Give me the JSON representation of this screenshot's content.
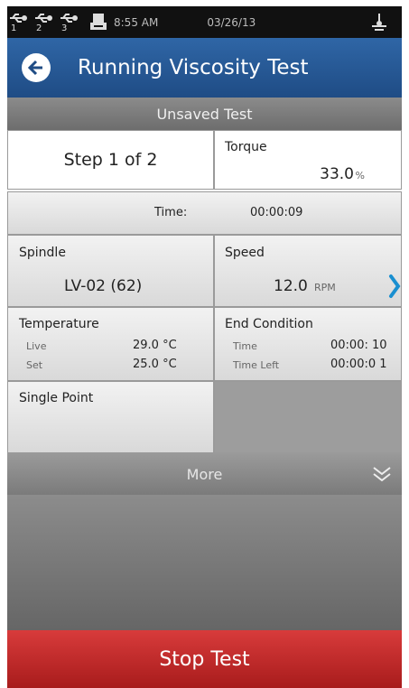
{
  "status_bar": {
    "usb_ports": [
      "1",
      "2",
      "3"
    ],
    "time": "8:55 AM",
    "date": "03/26/13",
    "icons": [
      "usb-icon",
      "printer-icon",
      "connection-icon"
    ]
  },
  "header": {
    "title": "Running Viscosity Test",
    "back_icon": "back-arrow-icon",
    "color": "#2a5f9e"
  },
  "subheader": {
    "text": "Unsaved Test"
  },
  "step": {
    "text": "Step  1 of 2"
  },
  "torque": {
    "label": "Torque",
    "value": "33.0",
    "unit": "%"
  },
  "time": {
    "label": "Time:",
    "value": "00:00:09"
  },
  "spindle": {
    "label": "Spindle",
    "value": "LV-02 (62)"
  },
  "speed": {
    "label": "Speed",
    "value": "12.0",
    "unit": "RPM",
    "chevron_icon": "chevron-right-icon",
    "chevron_color": "#1a8fd0"
  },
  "temperature": {
    "label": "Temperature",
    "live_label": "Live",
    "live_value": "29.0 °C",
    "set_label": "Set",
    "set_value": "25.0 °C"
  },
  "end_condition": {
    "label": "End Condition",
    "time_label": "Time",
    "time_value": "00:00: 10",
    "time_left_label": "Time Left",
    "time_left_value": "00:00:0 1"
  },
  "single_point": {
    "label": "Single Point"
  },
  "more": {
    "label": "More",
    "icon": "double-chevron-down-icon"
  },
  "stop": {
    "label": "Stop Test",
    "color": "#c62828"
  }
}
